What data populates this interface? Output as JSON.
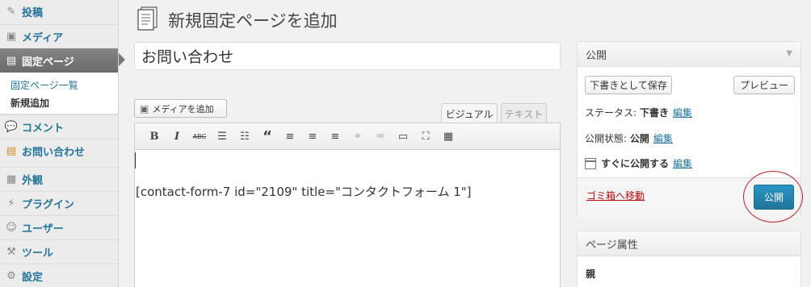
{
  "sidebar": {
    "items": [
      {
        "label": "投稿",
        "icon": "pin-icon"
      },
      {
        "label": "メディア",
        "icon": "media-icon"
      },
      {
        "label": "固定ページ",
        "icon": "pages-icon"
      },
      {
        "label": "コメント",
        "icon": "comment-icon"
      },
      {
        "label": "お問い合わせ",
        "icon": "contact-icon"
      },
      {
        "label": "外観",
        "icon": "appearance-icon"
      },
      {
        "label": "プラグイン",
        "icon": "plugin-icon"
      },
      {
        "label": "ユーザー",
        "icon": "users-icon"
      },
      {
        "label": "ツール",
        "icon": "tools-icon"
      },
      {
        "label": "設定",
        "icon": "settings-icon"
      }
    ],
    "submenu": [
      "固定ページ一覧",
      "新規追加"
    ]
  },
  "header": {
    "title": "新規固定ページを追加"
  },
  "editor": {
    "title_value": "お問い合わせ",
    "media_button": "メディアを追加",
    "tab_visual": "ビジュアル",
    "tab_text": "テキスト",
    "content": "[contact-form-7 id=\"2109\" title=\"コンタクトフォーム 1\"]",
    "toolbar": {
      "bold": "B",
      "italic": "I",
      "strike": "ABC",
      "quote": "“"
    }
  },
  "publish": {
    "heading": "公開",
    "save_draft": "下書きとして保存",
    "preview": "プレビュー",
    "status_label": "ステータス:",
    "status_value": "下書き",
    "visibility_label": "公開状態:",
    "visibility_value": "公開",
    "schedule_label": "すぐに公開する",
    "edit": "編集",
    "trash": "ゴミ箱へ移動",
    "publish_button": "公開"
  },
  "attributes": {
    "heading": "ページ属性",
    "parent_label": "親"
  },
  "colors": {
    "accent": "#21759b",
    "publish_button": "#2a8ab8",
    "trash": "#bc0b0b",
    "annotation": "#c0202a"
  }
}
